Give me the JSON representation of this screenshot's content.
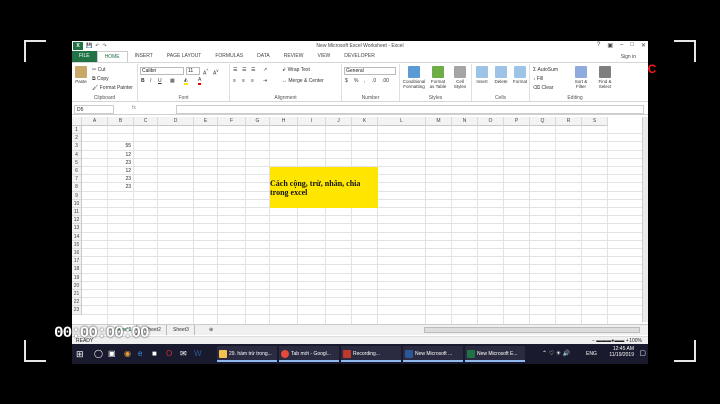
{
  "recording": {
    "rec_label": "REC",
    "timer": "00:00:00:00"
  },
  "window": {
    "title": "New Microsoft Excel Worksheet - Excel",
    "app_icon": "X",
    "buttons": [
      "?",
      "▣",
      "–",
      "□",
      "✕"
    ]
  },
  "ribbon_tabs": [
    "FILE",
    "HOME",
    "INSERT",
    "PAGE LAYOUT",
    "FORMULAS",
    "DATA",
    "REVIEW",
    "VIEW",
    "DEVELOPER"
  ],
  "signin": "Sign in",
  "ribbon": {
    "clipboard": {
      "label": "Clipboard",
      "paste": "Paste",
      "cut": "Cut",
      "copy": "Copy",
      "format_painter": "Format Painter"
    },
    "font": {
      "label": "Font",
      "name": "Calibri",
      "size": "11",
      "bold": "B",
      "italic": "I",
      "underline": "U"
    },
    "alignment": {
      "label": "Alignment",
      "wrap": "Wrap Text",
      "merge": "Merge & Center"
    },
    "number": {
      "label": "Number",
      "format": "General",
      "currency": "$",
      "percent": "%",
      "comma": ","
    },
    "styles": {
      "label": "Styles",
      "conditional": "Conditional Formatting",
      "format_table": "Format as Table",
      "cell_styles": "Cell Styles"
    },
    "cells": {
      "label": "Cells",
      "insert": "Insert",
      "delete": "Delete",
      "format": "Format"
    },
    "editing": {
      "label": "Editing",
      "autosum": "AutoSum",
      "fill": "Fill",
      "clear": "Clear",
      "sort": "Sort & Filter",
      "find": "Find & Select"
    }
  },
  "formula_bar": {
    "name_box": "D5",
    "fx": "fx",
    "value": ""
  },
  "columns": [
    "A",
    "B",
    "C",
    "D",
    "E",
    "F",
    "G",
    "H",
    "I",
    "J",
    "K",
    "L",
    "M",
    "N",
    "O",
    "P",
    "Q",
    "R",
    "S"
  ],
  "rows": [
    "1",
    "2",
    "3",
    "4",
    "5",
    "6",
    "7",
    "8",
    "9",
    "10",
    "11",
    "12",
    "13",
    "14",
    "15",
    "16",
    "17",
    "18",
    "19",
    "20",
    "21",
    "22",
    "23"
  ],
  "cells": [
    {
      "ref": "B3",
      "value": "55"
    },
    {
      "ref": "B4",
      "value": "12"
    },
    {
      "ref": "B5",
      "value": "23"
    },
    {
      "ref": "B6",
      "value": "12"
    },
    {
      "ref": "B7",
      "value": "23"
    },
    {
      "ref": "B8",
      "value": "23"
    }
  ],
  "highlight_text": "Cách cộng, trừ, nhân, chia trong excel",
  "sheet_tabs": [
    "Sheet1",
    "Sheet2",
    "Sheet3"
  ],
  "active_sheet": "Sheet1",
  "status": {
    "ready": "READY",
    "zoom": "100%"
  },
  "taskbar": {
    "items": [
      {
        "label": "29. hàm trừ trong...",
        "color": "#f2c14e"
      },
      {
        "label": "Tab mới - Googl...",
        "color": "#e64a3b"
      },
      {
        "label": "Recording...",
        "color": "#c0392b"
      },
      {
        "label": "New Microsoft ...",
        "color": "#2b5797"
      },
      {
        "label": "New Microsoft E...",
        "color": "#217346"
      }
    ],
    "lang": "ENG",
    "time": "12:45 AM",
    "date": "11/19/2019"
  },
  "colors": {
    "excel_green": "#217346",
    "highlight": "#ffe600",
    "rec_red": "#ff1a1a"
  }
}
